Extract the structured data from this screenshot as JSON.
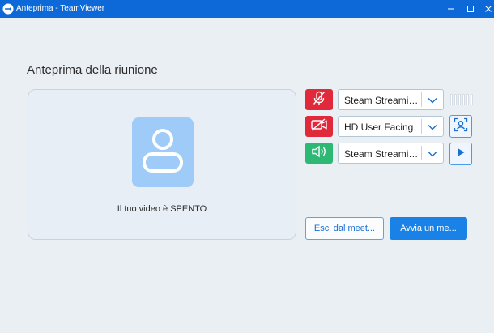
{
  "window": {
    "title": "Anteprima - TeamViewer",
    "icons": [
      "teamviewer-logo-icon",
      "minimize-icon",
      "maximize-icon",
      "close-icon"
    ]
  },
  "page": {
    "title": "Anteprima della riunione"
  },
  "preview": {
    "status": "Il tuo video è SPENTO",
    "icon": "user-icon"
  },
  "devices": {
    "microphone": {
      "selected": "Steam Streaming Microphone",
      "muted": true,
      "icon": "microphone-off-icon"
    },
    "camera": {
      "selected": "HD User Facing",
      "off": true,
      "icon": "camera-off-icon"
    },
    "speaker": {
      "selected": "Steam Streaming Speakers",
      "on": true,
      "icon": "speaker-icon"
    }
  },
  "buttons": {
    "leave": "Esci dal meet...",
    "start": "Avvia un me..."
  },
  "colors": {
    "titlebar": "#0e69d8",
    "muted": "#e0293b",
    "active": "#2db873",
    "primary": "#1a82e6",
    "avatar_tile": "#9ecbf7"
  }
}
